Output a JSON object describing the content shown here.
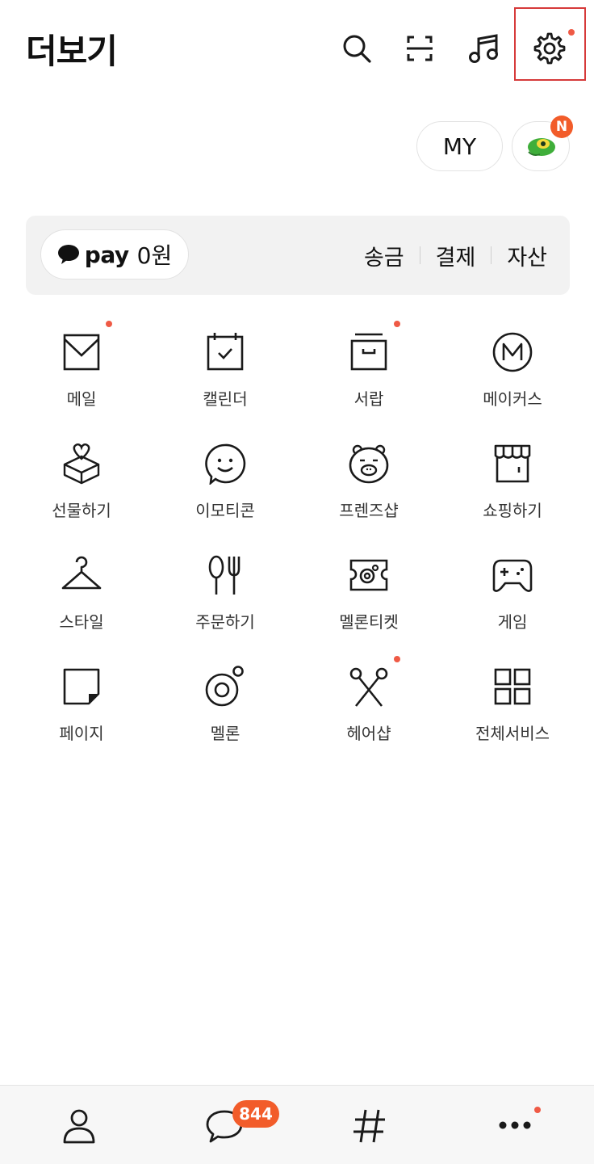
{
  "header": {
    "title": "더보기",
    "icons": [
      "search-icon",
      "scan-icon",
      "music-icon",
      "settings-icon"
    ]
  },
  "profile_buttons": {
    "my_label": "MY",
    "avatar_badge": "N"
  },
  "pay": {
    "logo": "pay",
    "amount": "0원",
    "links": [
      "송금",
      "결제",
      "자산"
    ]
  },
  "services": [
    {
      "label": "메일",
      "icon": "mail-icon",
      "dot": true
    },
    {
      "label": "캘린더",
      "icon": "calendar-icon",
      "dot": false
    },
    {
      "label": "서랍",
      "icon": "drawer-icon",
      "dot": true
    },
    {
      "label": "메이커스",
      "icon": "makers-icon",
      "dot": false
    },
    {
      "label": "선물하기",
      "icon": "gift-icon",
      "dot": false
    },
    {
      "label": "이모티콘",
      "icon": "emoticon-icon",
      "dot": false
    },
    {
      "label": "프렌즈샵",
      "icon": "friends-shop-icon",
      "dot": false
    },
    {
      "label": "쇼핑하기",
      "icon": "shopping-icon",
      "dot": false
    },
    {
      "label": "스타일",
      "icon": "hanger-icon",
      "dot": false
    },
    {
      "label": "주문하기",
      "icon": "fork-spoon-icon",
      "dot": false
    },
    {
      "label": "멜론티켓",
      "icon": "ticket-icon",
      "dot": false
    },
    {
      "label": "게임",
      "icon": "gamepad-icon",
      "dot": false
    },
    {
      "label": "페이지",
      "icon": "page-icon",
      "dot": false
    },
    {
      "label": "멜론",
      "icon": "melon-icon",
      "dot": false
    },
    {
      "label": "헤어샵",
      "icon": "scissors-icon",
      "dot": true
    },
    {
      "label": "전체서비스",
      "icon": "all-services-icon",
      "dot": false
    }
  ],
  "bottom_nav": {
    "items": [
      "friends-icon",
      "chat-icon",
      "hashtag-icon",
      "more-icon"
    ],
    "chat_badge": "844"
  },
  "colors": {
    "accent_badge": "#f25c2a",
    "red_dot": "#ef5a45",
    "highlight_frame": "#d63a3a",
    "pay_bar_bg": "#f2f2f2"
  }
}
